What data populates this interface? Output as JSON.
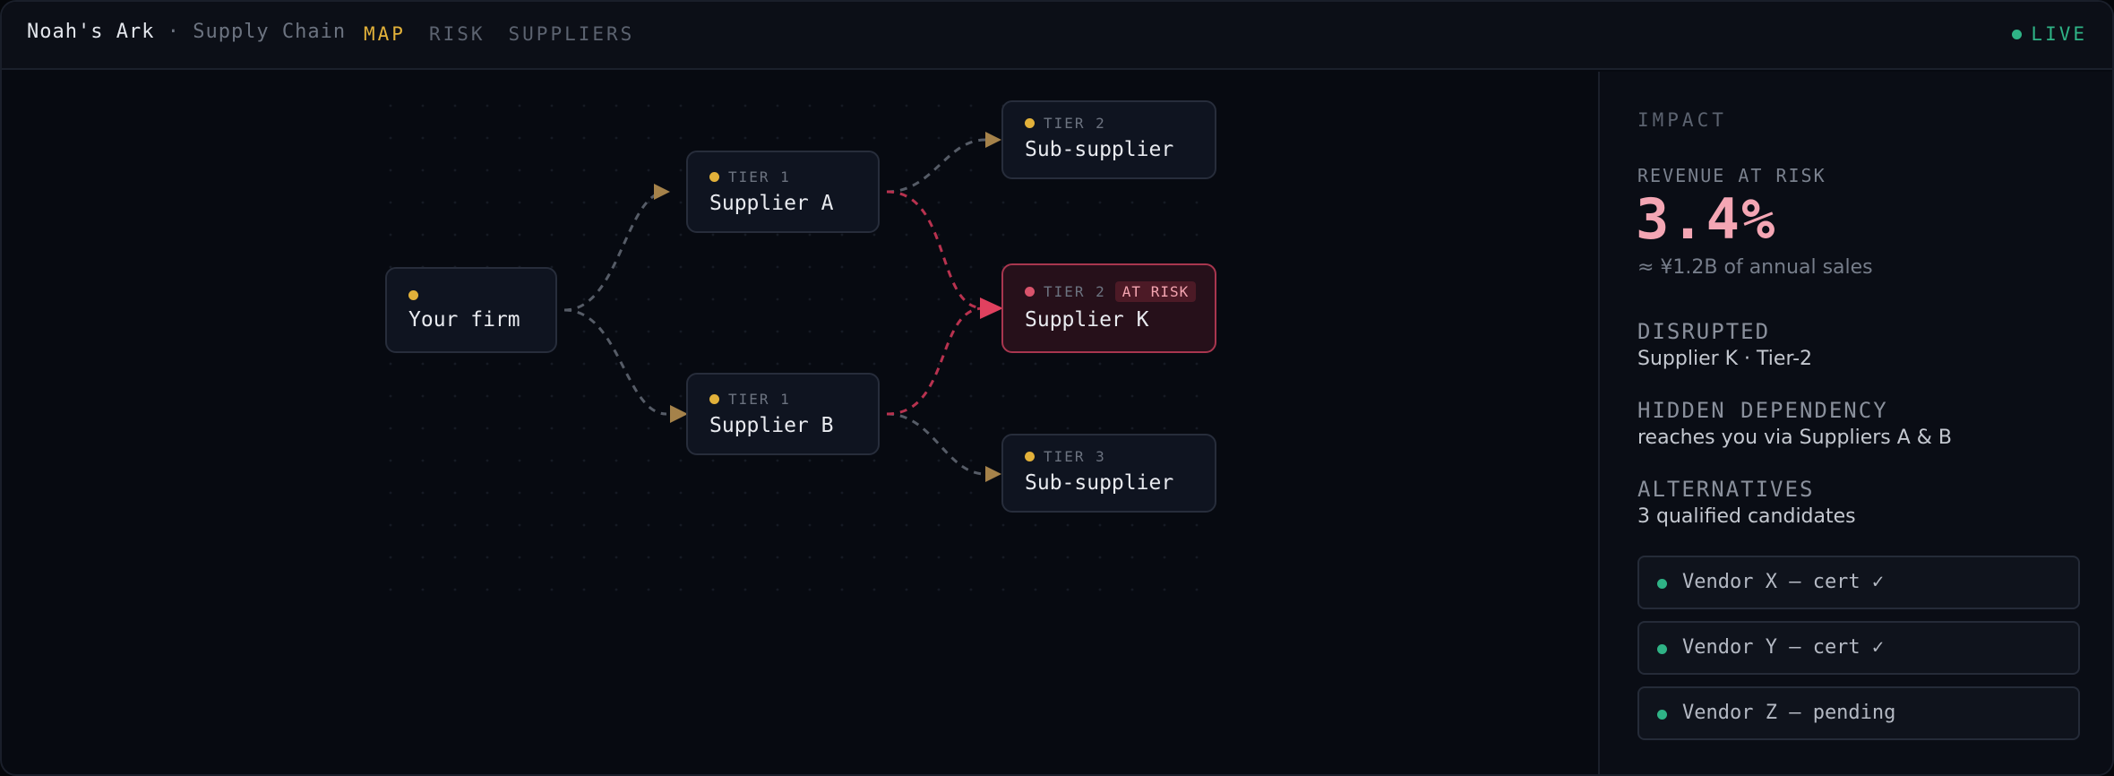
{
  "header": {
    "brand": "Noah's Ark",
    "separator": "·",
    "subtitle": "Supply Chain",
    "tabs": [
      {
        "label": "MAP",
        "active": true
      },
      {
        "label": "RISK",
        "active": false
      },
      {
        "label": "SUPPLIERS",
        "active": false
      }
    ],
    "status": "LIVE"
  },
  "map": {
    "nodes": {
      "your_firm": {
        "tier": "",
        "name": "Your firm"
      },
      "supplier_a": {
        "tier": "TIER 1",
        "name": "Supplier A"
      },
      "supplier_b": {
        "tier": "TIER 1",
        "name": "Supplier B"
      },
      "sub_supplier_t2": {
        "tier": "TIER 2",
        "name": "Sub-supplier"
      },
      "supplier_k": {
        "tier": "TIER 2",
        "name": "Supplier K",
        "badge": "AT RISK"
      },
      "sub_supplier_t3": {
        "tier": "TIER 3",
        "name": "Sub-supplier"
      }
    }
  },
  "impact": {
    "section_title": "IMPACT",
    "revenue_label": "REVENUE AT RISK",
    "revenue_value": "3.4%",
    "revenue_note": "≈ ¥1.2B of annual sales",
    "disrupted_label": "DISRUPTED",
    "disrupted_value": "Supplier K · Tier-2",
    "hidden_label": "HIDDEN DEPENDENCY",
    "hidden_value": "reaches you via Suppliers A & B",
    "alternatives_label": "ALTERNATIVES",
    "alternatives_value": "3 qualified candidates",
    "vendors": [
      "Vendor X — cert ✓",
      "Vendor Y — cert ✓",
      "Vendor Z — pending"
    ]
  },
  "colors": {
    "accent": "#e2b13a",
    "risk": "#e0415f",
    "live": "#2fb386",
    "edge": "#555b66"
  }
}
